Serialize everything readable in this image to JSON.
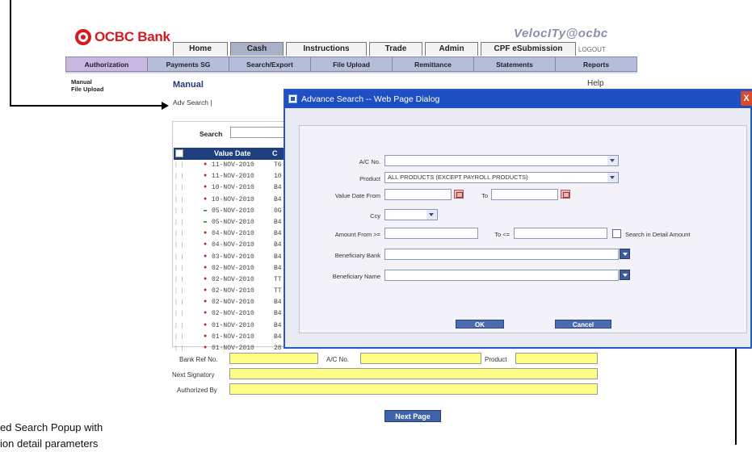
{
  "header": {
    "brand": "OCBC Bank",
    "product_logo": "VelocITy@ocbc",
    "logout": "LOGOUT",
    "tabs": [
      "Home",
      "Cash",
      "Instructions",
      "Trade",
      "Admin",
      "CPF eSubmission"
    ],
    "active_tab": "Cash",
    "subnav": [
      "Authorization",
      "Payments SG",
      "Search/Export",
      "File Upload",
      "Remittance",
      "Statements",
      "Reports"
    ],
    "active_subnav": "Authorization"
  },
  "sidebar": {
    "links": [
      "Manual",
      "File Upload"
    ]
  },
  "page": {
    "title": "Manual",
    "help": "Help",
    "adv_search": "Adv Search"
  },
  "list": {
    "search_label": "Search",
    "col_value_date": "Value Date",
    "col_ref": "C",
    "rows": [
      {
        "mark": "x",
        "date": "11-NOV-2010",
        "ref": "T6"
      },
      {
        "mark": "x",
        "date": "11-NOV-2010",
        "ref": "10"
      },
      {
        "mark": "x",
        "date": "10-NOV-2010",
        "ref": "B4"
      },
      {
        "mark": "x",
        "date": "10-NOV-2010",
        "ref": "B4"
      },
      {
        "mark": "m",
        "date": "05-NOV-2010",
        "ref": "0G"
      },
      {
        "mark": "m",
        "date": "05-NOV-2010",
        "ref": "B4"
      },
      {
        "mark": "x",
        "date": "04-NOV-2010",
        "ref": "B4"
      },
      {
        "mark": "x",
        "date": "04-NOV-2010",
        "ref": "B4"
      },
      {
        "mark": "x",
        "date": "03-NOV-2010",
        "ref": "B4"
      },
      {
        "mark": "x",
        "date": "02-NOV-2010",
        "ref": "B4"
      },
      {
        "mark": "x",
        "date": "02-NOV-2010",
        "ref": "TT"
      },
      {
        "mark": "x",
        "date": "02-NOV-2010",
        "ref": "TT"
      },
      {
        "mark": "x",
        "date": "02-NOV-2010",
        "ref": "B4"
      },
      {
        "mark": "x",
        "date": "02-NOV-2010",
        "ref": "B4"
      },
      {
        "mark": "x",
        "date": "01-NOV-2010",
        "ref": "B4"
      },
      {
        "mark": "x",
        "date": "01-NOV-2010",
        "ref": "B4"
      },
      {
        "mark": "x",
        "date": "01-NOV-2010",
        "ref": "28"
      }
    ]
  },
  "detail": {
    "bank_ref": "Bank Ref No.",
    "ac_no": "A/C No.",
    "product": "Product",
    "next_signatory": "Next Signatory",
    "authorized_by": "Authorized By",
    "next_page": "Next Page"
  },
  "dialog": {
    "title": "Advance Search -- Web Page Dialog",
    "close": "X",
    "ac_no_label": "A/C No.",
    "product_label": "Product",
    "product_value": "ALL PRODUCTS (EXCEPT PAYROLL PRODUCTS)",
    "value_date_from_label": "Value Date From",
    "to_label": "To",
    "ccy_label": "Ccy",
    "amount_from_label": "Amount From >=",
    "amount_to_label": "To <=",
    "search_in_detail_label": "Search in Detail Amount",
    "beneficiary_bank_label": "Beneficiary Bank",
    "beneficiary_name_label": "Beneficiary Name",
    "ok": "OK",
    "cancel": "Cancel"
  },
  "annotation": {
    "caption_line1": "ed Search Popup with",
    "caption_line2": "ion detail parameters"
  }
}
